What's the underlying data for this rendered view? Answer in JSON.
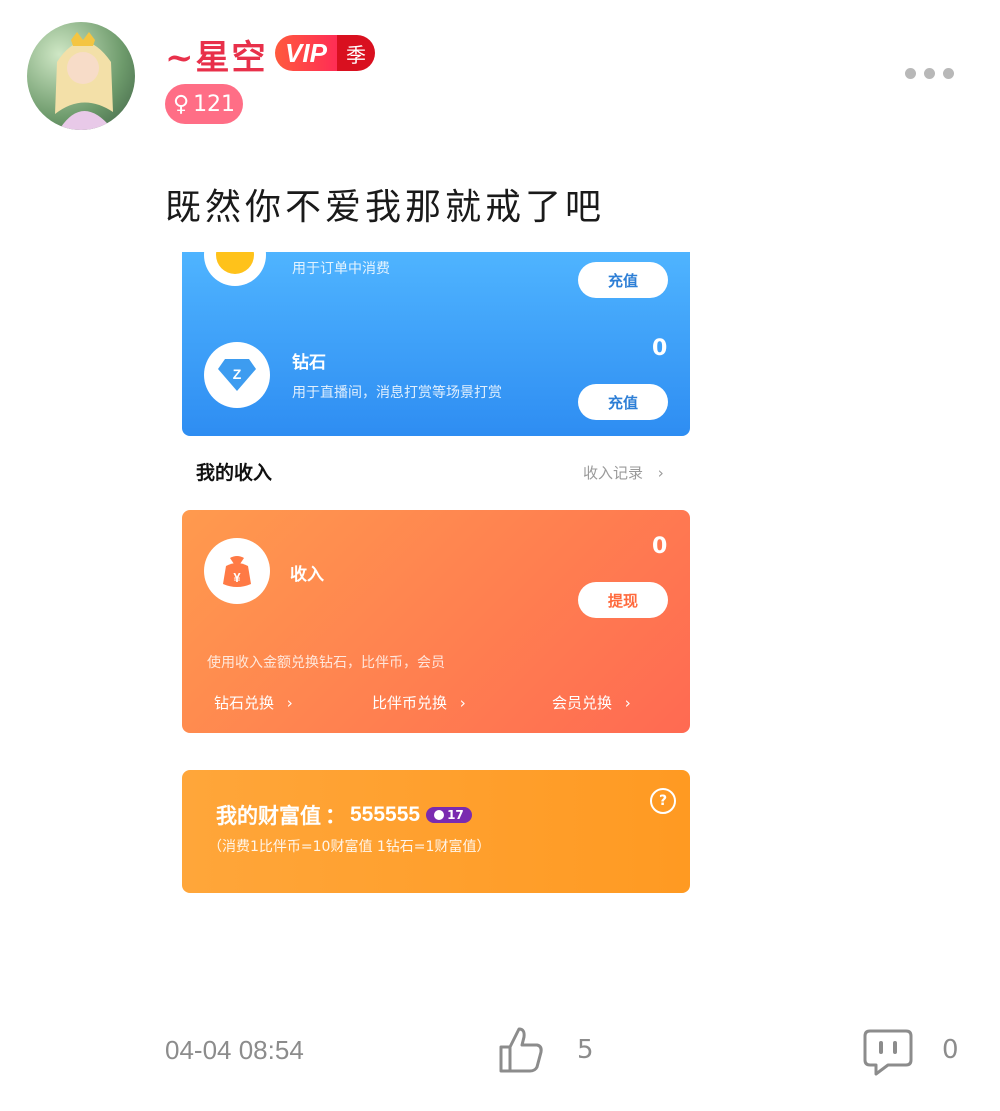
{
  "header": {
    "username": "~星空",
    "vip_label": "VIP",
    "vip_tier": "季",
    "gender_symbol": "♀",
    "gender_count": "121"
  },
  "post": {
    "text": "既然你不爱我那就戒了吧"
  },
  "screenshot": {
    "coin": {
      "desc": "用于订单中消费",
      "button": "充值"
    },
    "diamond": {
      "title": "钻石",
      "value": "0",
      "desc": "用于直播间，消息打赏等场景打赏",
      "button": "充值",
      "icon_letter": "Z"
    },
    "income_section": {
      "title": "我的收入",
      "link": "收入记录"
    },
    "income": {
      "title": "收入",
      "value": "0",
      "button": "提现",
      "desc": "使用收入金额兑换钻石，比伴币，会员",
      "actions": [
        "钻石兑换",
        "比伴币兑换",
        "会员兑换"
      ],
      "currency_symbol": "¥"
    },
    "wealth": {
      "label": "我的财富值",
      "separator": "：",
      "value": "555555",
      "level": "17",
      "note": "（消费1比伴币=10财富值 1钻石=1财富值）",
      "help_symbol": "?"
    }
  },
  "footer": {
    "timestamp": "04-04 08:54",
    "like_count": "5",
    "comment_count": "0"
  },
  "colors": {
    "username": "#e8304a",
    "blue_card": "#3aa0f8",
    "orange_card": "#ff7e50",
    "wealth_card": "#ffa230"
  }
}
